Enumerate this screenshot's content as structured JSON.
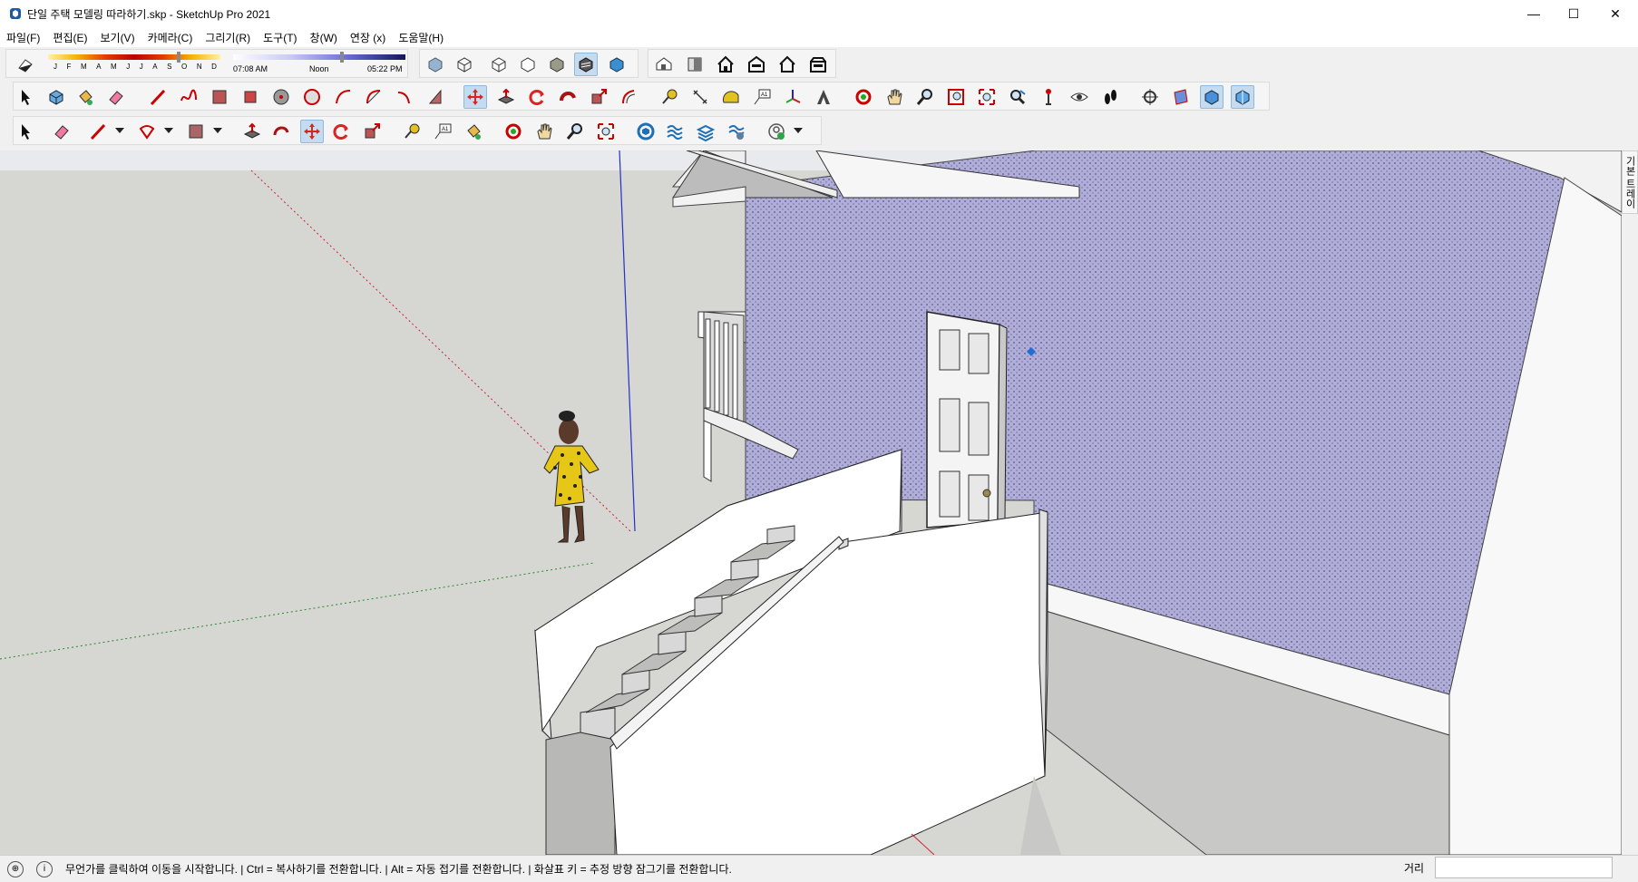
{
  "window": {
    "title": "단일 주택 모델링 따라하기.skp - SketchUp Pro 2021",
    "minimize": "—",
    "maximize": "☐",
    "close": "✕"
  },
  "menu": [
    "파일(F)",
    "편집(E)",
    "보기(V)",
    "카메라(C)",
    "그리기(R)",
    "도구(T)",
    "창(W)",
    "연장 (x)",
    "도움말(H)"
  ],
  "shadows": {
    "months": [
      "J",
      "F",
      "M",
      "A",
      "M",
      "J",
      "J",
      "A",
      "S",
      "O",
      "N",
      "D"
    ],
    "time_start": "07:08 AM",
    "time_mid": "Noon",
    "time_end": "05:22 PM"
  },
  "toolbar_row1": [
    "styles-xray-icon",
    "styles-wireframe-icon",
    "styles-hidden-line-icon",
    "styles-shaded-icon",
    "styles-shaded-texture-icon",
    "styles-monochrome-icon",
    "views-iso-icon",
    "views-top-icon",
    "views-front-icon",
    "views-right-icon",
    "views-back-icon",
    "views-left-icon"
  ],
  "toolbar_row2": [
    "select-icon",
    "make-component-icon",
    "paint-bucket-icon",
    "eraser-icon",
    "line-icon",
    "freehand-icon",
    "rectangle-icon",
    "rotated-rectangle-icon",
    "circle-icon",
    "polygon-icon",
    "arc-icon",
    "two-point-arc-icon",
    "three-point-arc-icon",
    "pie-icon",
    "move-icon",
    "push-pull-icon",
    "rotate-icon",
    "follow-me-icon",
    "scale-icon",
    "offset-icon",
    "tape-measure-icon",
    "dimension-icon",
    "protractor-icon",
    "text-icon",
    "axes-icon",
    "3d-text-icon",
    "orbit-icon",
    "pan-icon",
    "zoom-icon",
    "zoom-window-icon",
    "zoom-extents-icon",
    "previous-view-icon",
    "position-camera-icon",
    "look-around-icon",
    "walk-icon",
    "section-plane-icon",
    "display-section-planes-icon",
    "display-section-cuts-icon",
    "display-section-fill-icon"
  ],
  "toolbar_row3": [
    "select-icon",
    "eraser-icon",
    "pencil-icon",
    "arc-icon",
    "rectangle-icon",
    "push-pull-icon",
    "offset-icon",
    "move-icon",
    "rotate-icon",
    "scale-icon",
    "tape-measure-icon",
    "text-icon",
    "paint-bucket-icon",
    "orbit-icon",
    "pan-icon",
    "zoom-icon",
    "zoom-extents-icon",
    "3d-warehouse-icon",
    "extension-warehouse-icon",
    "layout-icon",
    "extension-manager-icon",
    "account-icon"
  ],
  "tray_tab": "기본 트레이",
  "status": {
    "message": "무언가를 클릭하여 이동을 시작합니다. | Ctrl = 복사하기를 전환합니다. | Alt = 자동 접기를 전환합니다. | 화살표 키 = 추정 방향 잠그기를 전환합니다.",
    "vcb_label": "거리",
    "vcb_value": ""
  },
  "colors": {
    "viewport_bg": "#d6d6d3",
    "wall_purple": "#a9a7cf",
    "active_tool": "#c5dcf0"
  }
}
